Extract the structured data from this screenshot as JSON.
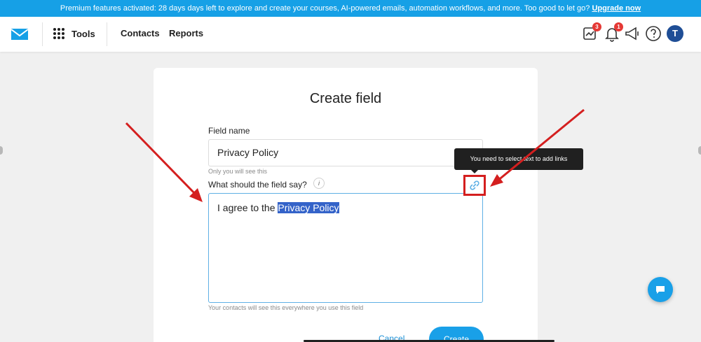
{
  "banner": {
    "text": "Premium features activated: 28 days days left to explore and create your courses, AI-powered emails, automation workflows, and more. Too good to let go?",
    "link": "Upgrade now"
  },
  "topbar": {
    "tools_label": "Tools",
    "nav": [
      "Contacts",
      "Reports"
    ],
    "badges": {
      "tasks": "3",
      "notifications": "1"
    },
    "avatar_initial": "T"
  },
  "form": {
    "title": "Create field",
    "field_name_label": "Field name",
    "field_name_value": "Privacy Policy",
    "field_name_hint": "Only you will see this",
    "field_say_label": "What should the field say?",
    "info_glyph": "i",
    "editor_text_before": "I agree to the",
    "editor_text_selected": "Privacy Policy",
    "editor_hint": "Your contacts will see this everywhere you use this field",
    "tooltip": "You need to select text to add links",
    "cancel_label": "Cancel",
    "create_label": "Create"
  },
  "colors": {
    "accent": "#19a0e8",
    "banner": "#16a0e6",
    "highlight": "#d41f1f",
    "selection": "#3463c9",
    "avatar": "#1f4e96"
  },
  "icons": [
    "mail-logo-icon",
    "apps-grid-icon",
    "tasks-icon",
    "bell-icon",
    "megaphone-icon",
    "help-icon",
    "link-icon",
    "chat-icon",
    "annotation-arrow-icon"
  ]
}
